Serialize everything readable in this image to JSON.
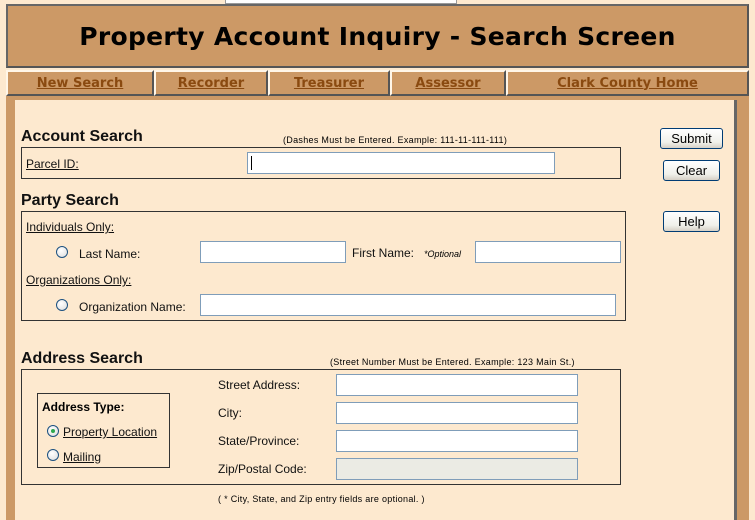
{
  "header": {
    "title": "Property Account Inquiry - Search Screen"
  },
  "nav": {
    "items": [
      {
        "label": "New Search"
      },
      {
        "label": "Recorder"
      },
      {
        "label": "Treasurer"
      },
      {
        "label": "Assessor"
      },
      {
        "label": "Clark County Home"
      }
    ]
  },
  "account_search": {
    "title": "Account Search",
    "hint": "(Dashes Must be Entered. Example: 111-11-111-111)",
    "parcel_label": "Parcel ID:",
    "parcel_value": ""
  },
  "party_search": {
    "title": "Party Search",
    "individuals_label": "Individuals Only:",
    "last_name_label": "Last Name:",
    "last_name_value": "",
    "first_name_label": "First Name:",
    "first_name_optional": "*Optional",
    "first_name_value": "",
    "organizations_label": "Organizations Only:",
    "org_name_label": "Organization Name:",
    "org_name_value": ""
  },
  "address_search": {
    "title": "Address Search",
    "hint": "(Street Number Must be Entered. Example: 123 Main St.)",
    "address_type_label": "Address Type:",
    "address_types": [
      {
        "label": "Property Location",
        "selected": true
      },
      {
        "label": "Mailing",
        "selected": false
      }
    ],
    "street_label": "Street Address:",
    "street_value": "",
    "city_label": "City:",
    "city_value": "",
    "state_label": "State/Province:",
    "state_value": "",
    "zip_label": "Zip/Postal Code:",
    "zip_value": "",
    "footnote": "( * City, State, and Zip entry fields are optional. )"
  },
  "buttons": {
    "submit": "Submit",
    "clear": "Clear",
    "help": "Help"
  },
  "colors": {
    "header_bg": "#cc9966",
    "page_bg": "#fde9cf",
    "link": "#8a4a10"
  }
}
